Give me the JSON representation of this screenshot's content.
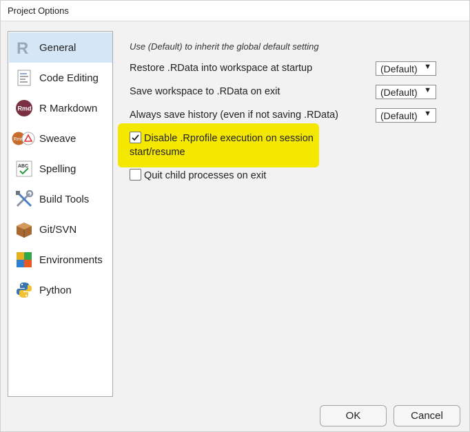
{
  "window": {
    "title": "Project Options"
  },
  "sidebar": {
    "items": [
      {
        "label": "General",
        "icon": "r-logo-icon",
        "selected": true
      },
      {
        "label": "Code Editing",
        "icon": "code-editing-icon",
        "selected": false
      },
      {
        "label": "R Markdown",
        "icon": "rmarkdown-icon",
        "selected": false
      },
      {
        "label": "Sweave",
        "icon": "sweave-icon",
        "selected": false
      },
      {
        "label": "Spelling",
        "icon": "spelling-icon",
        "selected": false
      },
      {
        "label": "Build Tools",
        "icon": "build-tools-icon",
        "selected": false
      },
      {
        "label": "Git/SVN",
        "icon": "git-svn-icon",
        "selected": false
      },
      {
        "label": "Environments",
        "icon": "environments-icon",
        "selected": false
      },
      {
        "label": "Python",
        "icon": "python-icon",
        "selected": false
      }
    ]
  },
  "general": {
    "hint": "Use (Default) to inherit the global default setting",
    "restore_rdata": {
      "label": "Restore .RData into workspace at startup",
      "value": "(Default)"
    },
    "save_workspace": {
      "label": "Save workspace to .RData on exit",
      "value": "(Default)"
    },
    "always_save_history": {
      "label": "Always save history (even if not saving .RData)",
      "value": "(Default)"
    },
    "disable_rprofile": {
      "line1": "Disable .Rprofile execution on session",
      "line2": "start/resume",
      "checked": true
    },
    "quit_child": {
      "label": "Quit child processes on exit",
      "checked": false
    }
  },
  "buttons": {
    "ok": "OK",
    "cancel": "Cancel"
  },
  "colors": {
    "highlight": "#f5e800",
    "selected_nav": "#d5e6f7"
  }
}
